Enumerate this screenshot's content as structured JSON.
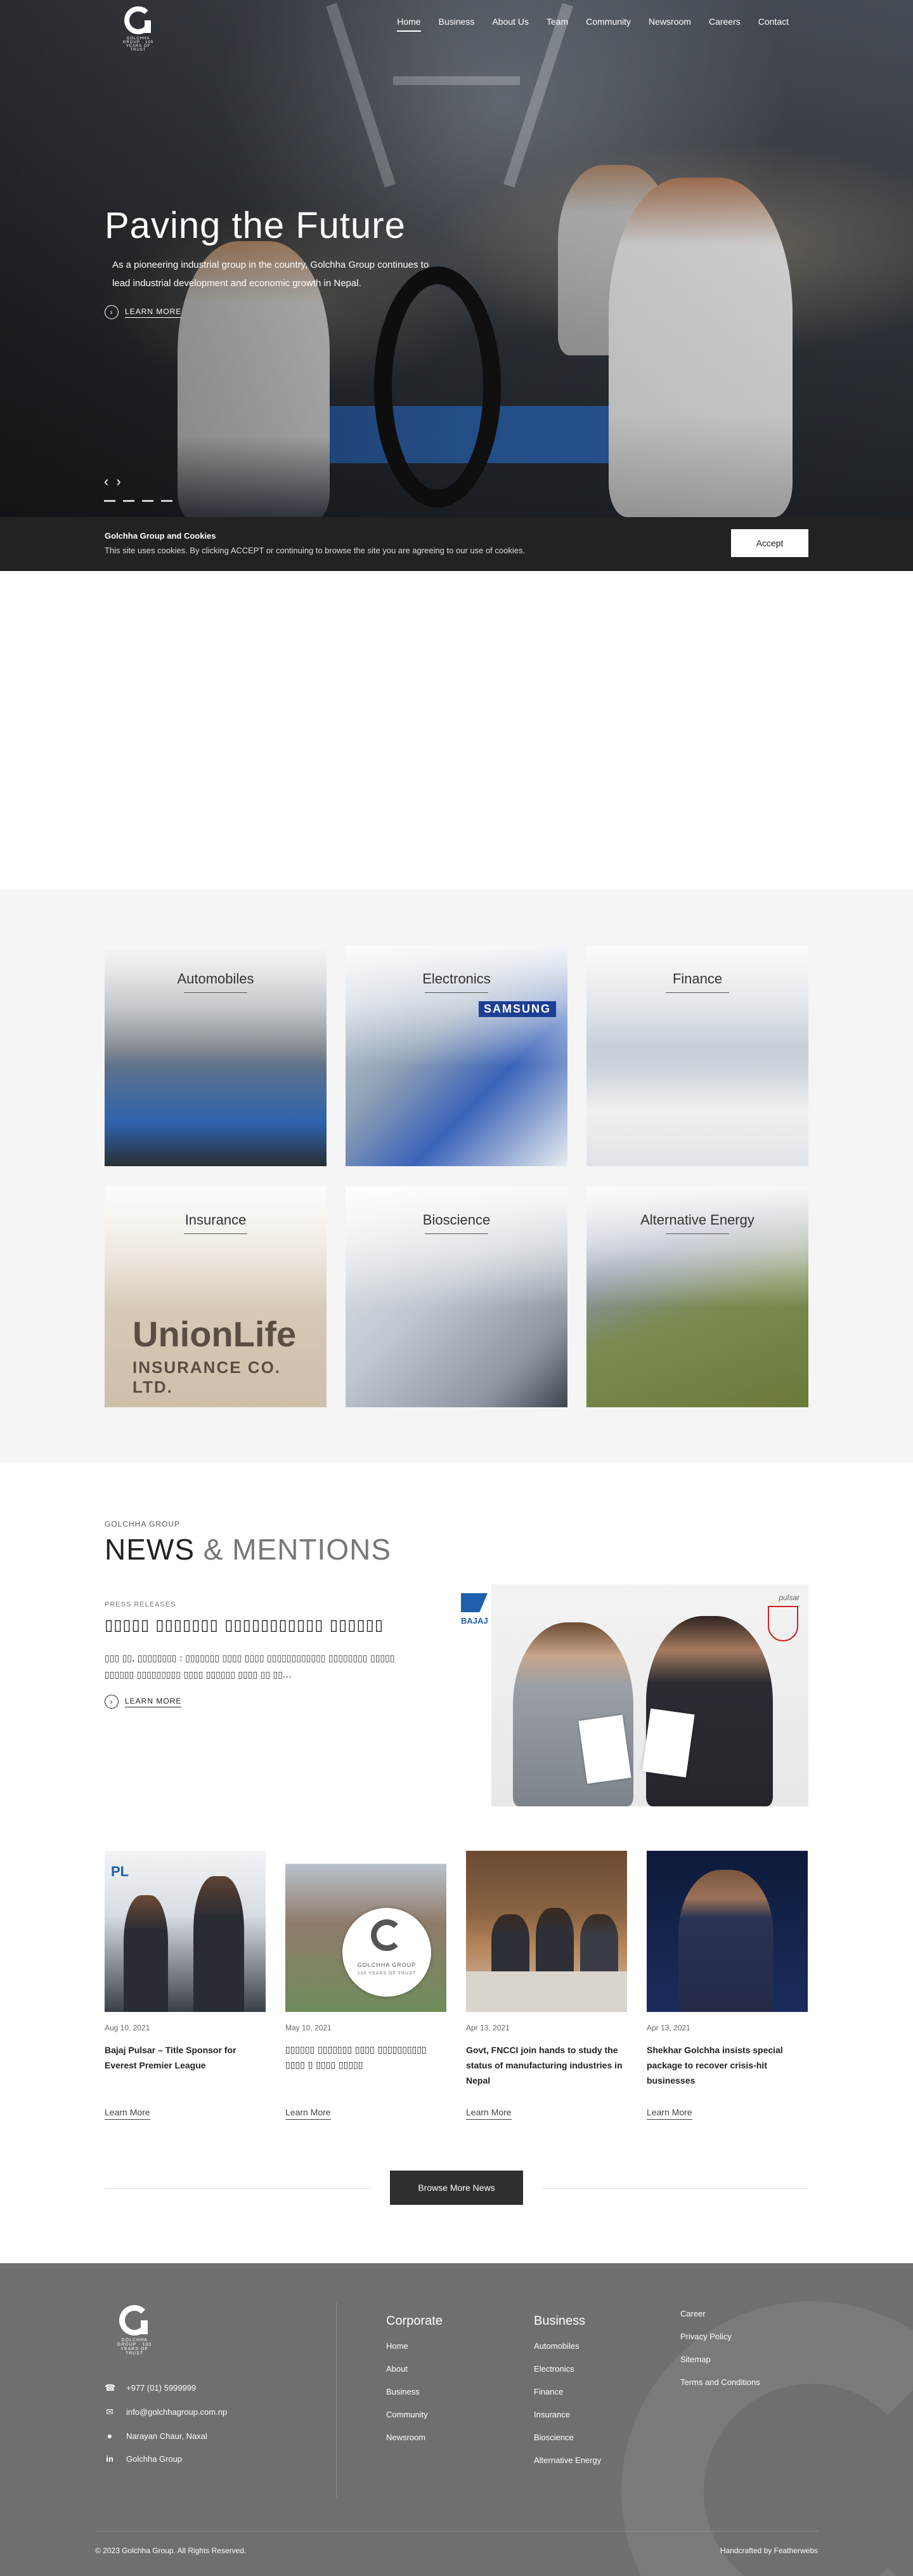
{
  "brand": {
    "logo_text": "GOLCHHA GROUP · 100 YEARS OF TRUST"
  },
  "nav": {
    "items": [
      "Home",
      "Business",
      "About Us",
      "Team",
      "Community",
      "Newsroom",
      "Careers",
      "Contact"
    ],
    "active": "Home"
  },
  "hero": {
    "title": "Paving the Future",
    "text": "As a pioneering industrial group in the country, Golchha Group continues to lead industrial development and economic growth in Nepal.",
    "learn_more": "LEARN MORE",
    "prev": "‹",
    "next": "›",
    "slides": 4
  },
  "cookie": {
    "title": "Golchha Group and Cookies",
    "text": "This site uses cookies. By clicking ACCEPT or continuing to browse the site you are agreeing to our use of cookies.",
    "accept": "Accept"
  },
  "business": {
    "cards": [
      "Automobiles",
      "Electronics",
      "Finance",
      "Insurance",
      "Bioscience",
      "Alternative Energy"
    ],
    "insurance_sign": "UnionLife",
    "insurance_sign_sub": "INSURANCE CO. LTD.",
    "electronics_sign": "SAMSUNG"
  },
  "news": {
    "eyebrow": "GOLCHHA GROUP",
    "title_main": "NEWS",
    "title_light": "& MENTIONS",
    "feature": {
      "category": "PRESS RELEASES",
      "title": "▯▯▯▯▯ ▯▯▯▯▯▯▯ ▯▯▯▯▯▯▯▯▯▯▯ ▯▯▯▯▯▯",
      "excerpt": "▯▯▯ ▯▯, ▯▯▯▯▯▯▯▯ : ▯▯▯▯▯▯▯ ▯▯▯▯ ▯▯▯▯ ▯▯▯▯▯▯▯▯▯▯▯▯ ▯▯▯▯▯▯▯▯ ▯▯▯▯▯ ▯▯▯▯▯▯ ▯▯▯▯▯▯▯▯▯ ▯▯▯▯ ▯▯▯▯▯▯ ▯▯▯▯ ▯▯ ▯▯...",
      "learn_more": "LEARN MORE",
      "brand_left": "BAJAJ",
      "brand_right": "pulsar"
    },
    "cards": [
      {
        "date": "Aug 10, 2021",
        "title": "Bajaj Pulsar – Title Sponsor for Everest Premier League",
        "more": "Learn More"
      },
      {
        "date": "May 10, 2021",
        "title": "▯▯▯▯▯▯ ▯▯▯▯▯▯▯ ▯▯▯▯ ▯▯▯▯▯▯▯▯▯▯ ▯▯▯▯ ▯ ▯▯▯▯ ▯▯▯▯▯",
        "more": "Learn More"
      },
      {
        "date": "Apr 13, 2021",
        "title": "Govt, FNCCI join hands to study the status of manufacturing industries in Nepal",
        "more": "Learn More"
      },
      {
        "date": "Apr 13, 2021",
        "title": "Shekhar Golchha insists special package to recover crisis-hit businesses",
        "more": "Learn More"
      }
    ],
    "browse": "Browse More News",
    "card2_badge_name": "GOLCHHA GROUP",
    "card2_badge_sub": "100 YEARS OF TRUST"
  },
  "footer": {
    "contact": {
      "phone": "+977 (01) 5999999",
      "email": "info@golchhagroup.com.np",
      "address": "Narayan Chaur, Naxal",
      "linkedin": "Golchha Group"
    },
    "corporate": {
      "heading": "Corporate",
      "links": [
        "Home",
        "About",
        "Business",
        "Community",
        "Newsroom"
      ]
    },
    "business": {
      "heading": "Business",
      "links": [
        "Automobiles",
        "Electronics",
        "Finance",
        "Insurance",
        "Bioscience",
        "Alternative Energy"
      ]
    },
    "misc": {
      "links": [
        "Career",
        "Privacy Policy",
        "Sitemap",
        "Terms and Conditions"
      ]
    },
    "copyright": "© 2023 Golchha Group. All Rights Reserved.",
    "credit": "Handcrafted by Featherwebs"
  },
  "colors": {
    "dark": "#222222",
    "footer": "#6e6f73",
    "section_bg": "#f5f5f5",
    "accent_blue": "#2a66b8"
  }
}
